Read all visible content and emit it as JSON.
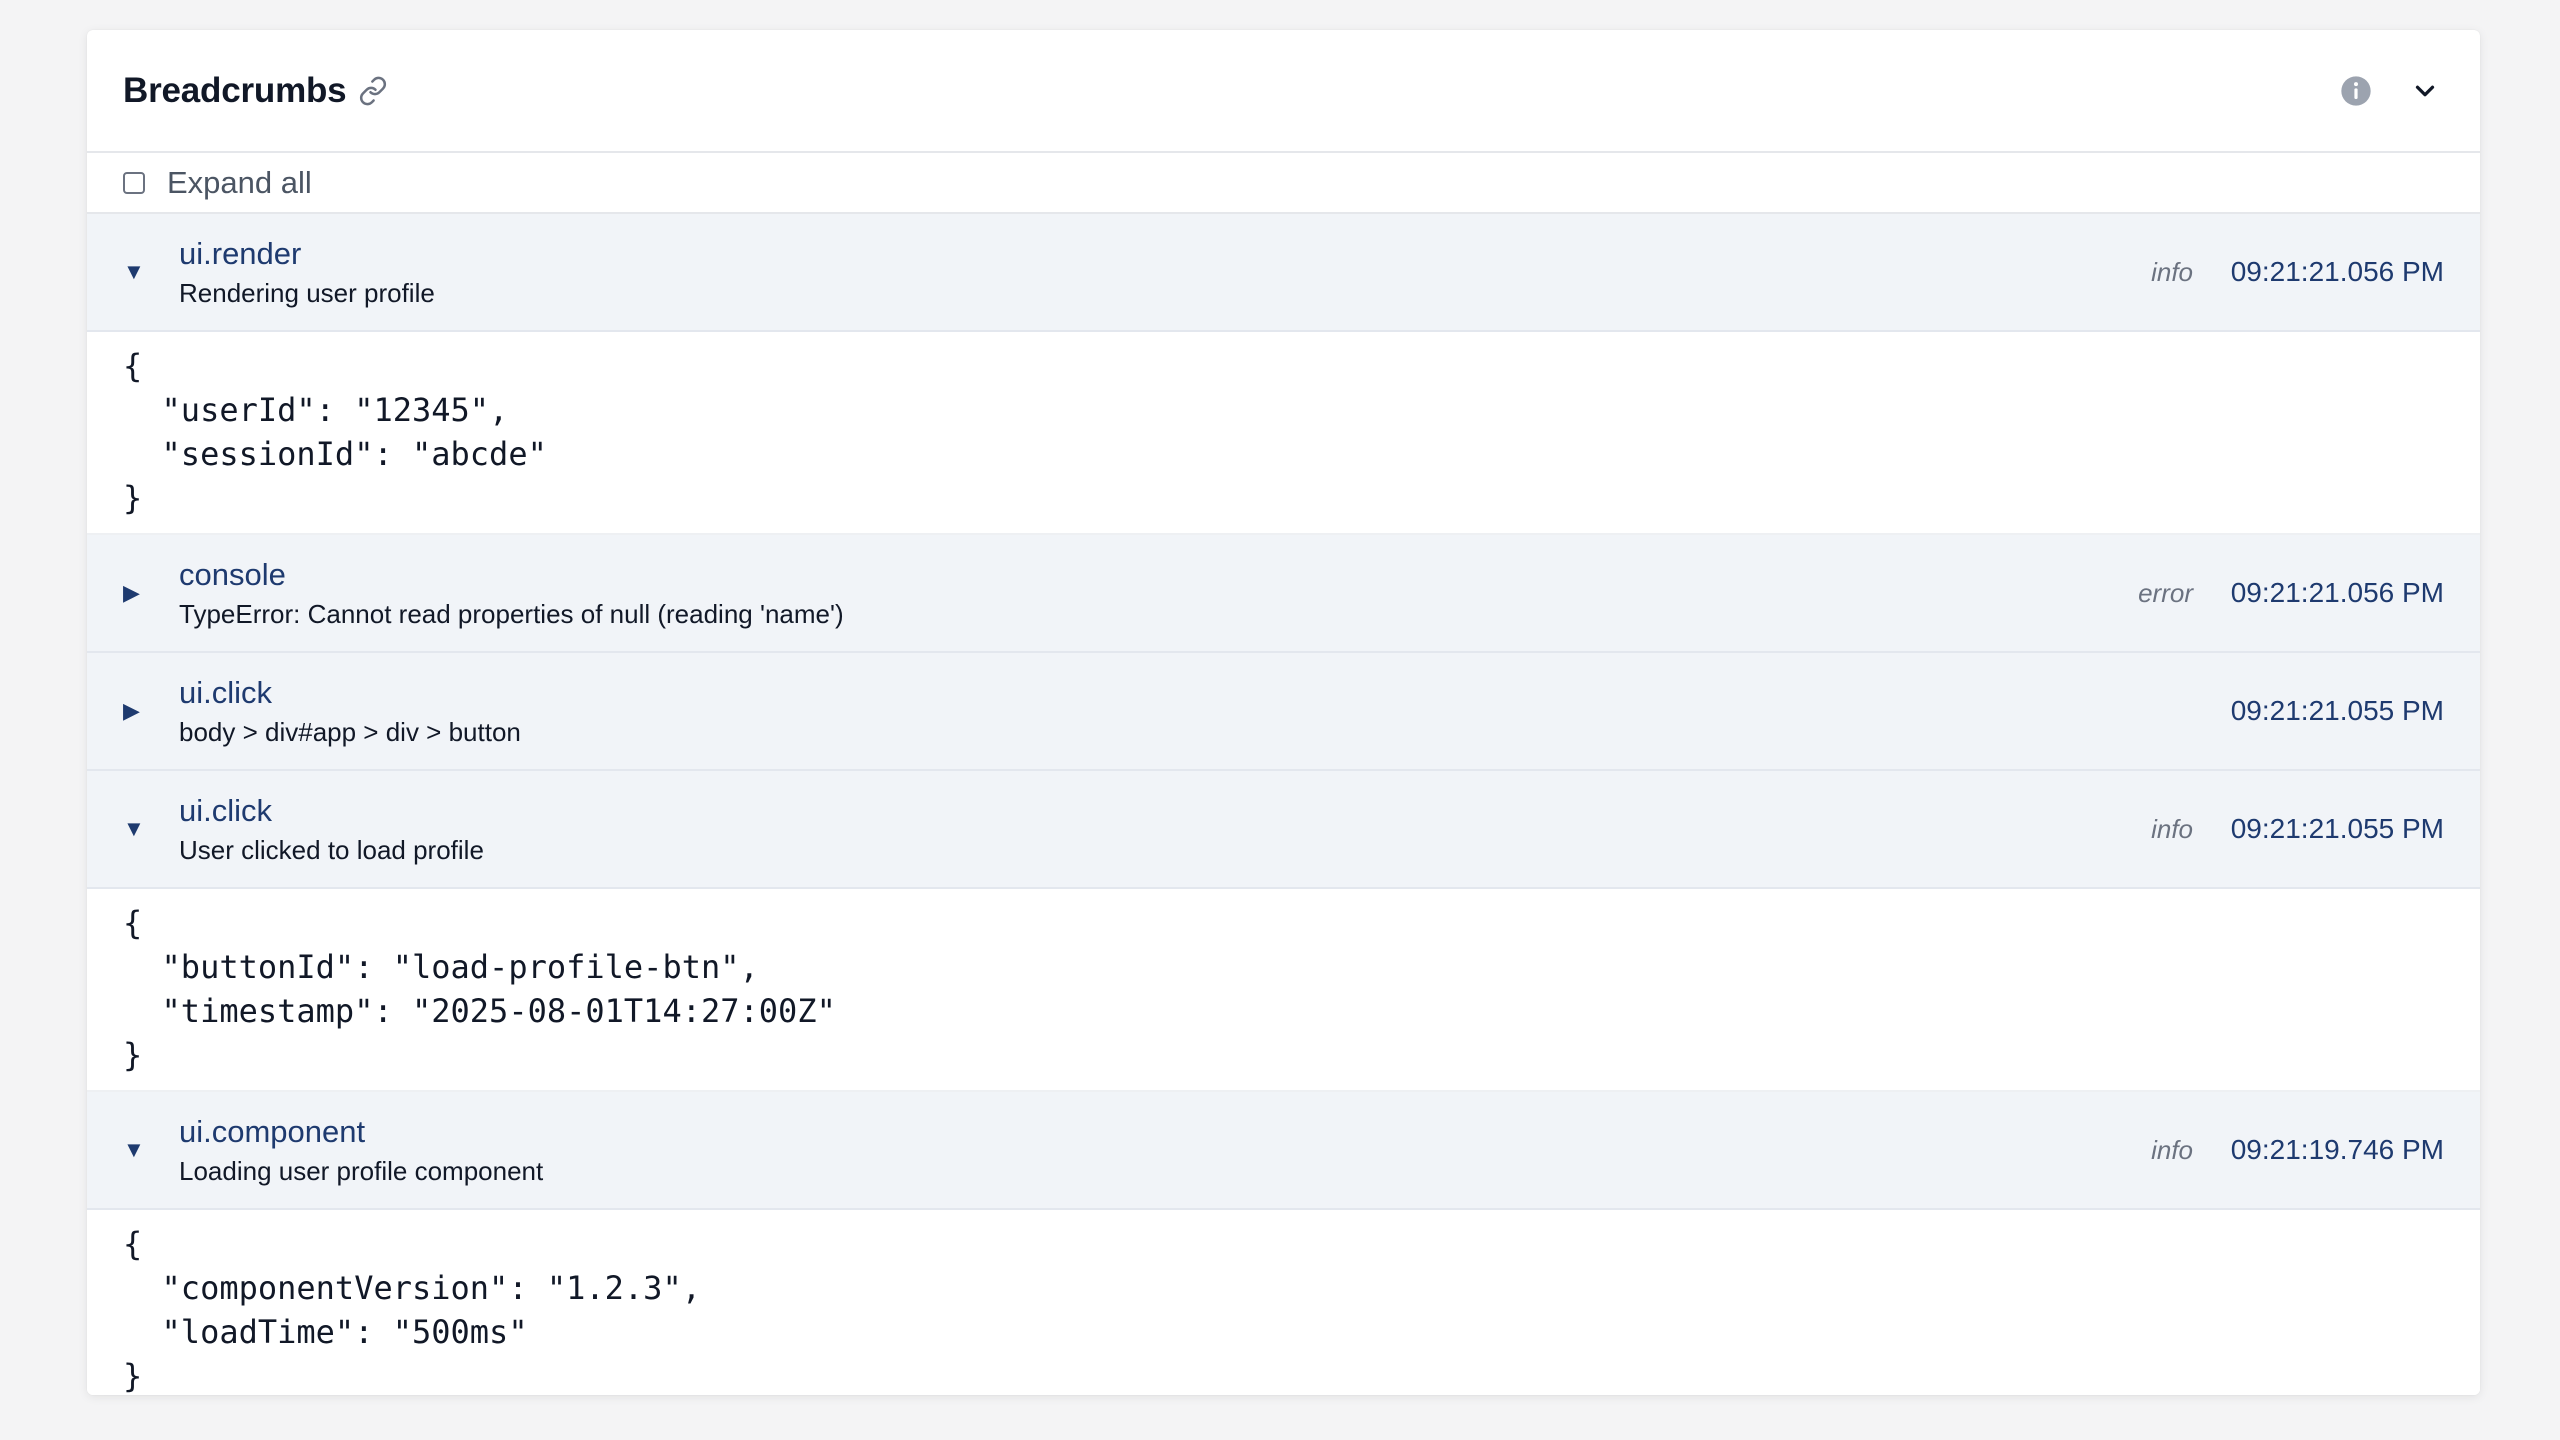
{
  "panel": {
    "title": "Breadcrumbs",
    "link_icon": "link-icon",
    "info_icon": "info-icon",
    "collapse_icon": "chevron-down-icon"
  },
  "expand_all": {
    "label": "Expand all",
    "checked": false
  },
  "crumbs": [
    {
      "toggle": "▼",
      "category": "ui.render",
      "message": "Rendering user profile",
      "level": "info",
      "time": "09:21:21.056 PM",
      "data": "{\n  \"userId\": \"12345\",\n  \"sessionId\": \"abcde\"\n}"
    },
    {
      "toggle": "▶",
      "category": "console",
      "message": "TypeError: Cannot read properties of null (reading 'name')",
      "level": "error",
      "time": "09:21:21.056 PM"
    },
    {
      "toggle": "▶",
      "category": "ui.click",
      "message": "body > div#app > div > button",
      "level": "",
      "time": "09:21:21.055 PM"
    },
    {
      "toggle": "▼",
      "category": "ui.click",
      "message": "User clicked to load profile",
      "level": "info",
      "time": "09:21:21.055 PM",
      "data": "{\n  \"buttonId\": \"load-profile-btn\",\n  \"timestamp\": \"2025-08-01T14:27:00Z\"\n}"
    },
    {
      "toggle": "▼",
      "category": "ui.component",
      "message": "Loading user profile component",
      "level": "info",
      "time": "09:21:19.746 PM",
      "data": "{\n  \"componentVersion\": \"1.2.3\",\n  \"loadTime\": \"500ms\"\n}"
    }
  ]
}
